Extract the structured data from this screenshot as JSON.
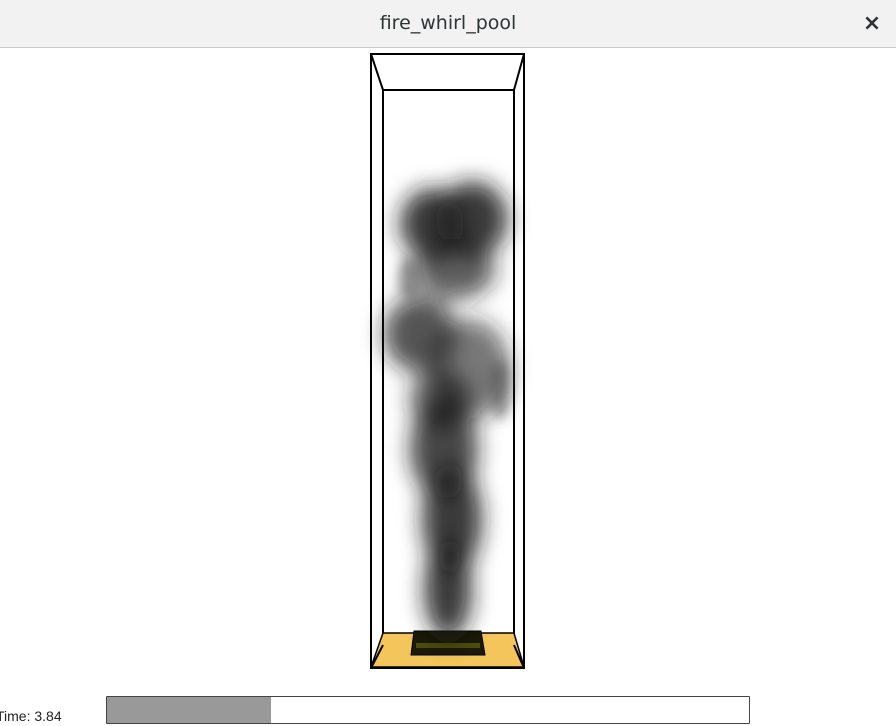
{
  "window": {
    "title": "fire_whirl_pool",
    "close_label": "×"
  },
  "simulation": {
    "time_text": "Time: 3.84",
    "time_value": 3.84,
    "progress_fraction": 0.255
  },
  "colors": {
    "pool_floor": "#f3c55a",
    "pool_source": "#1a1a08",
    "smoke": "#1a1a1a",
    "progress_fill": "#999999"
  }
}
